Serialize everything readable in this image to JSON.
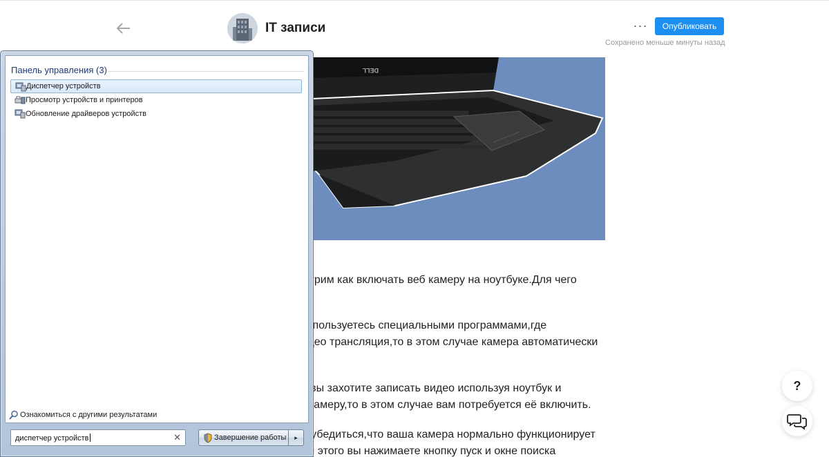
{
  "editor": {
    "channel_title": "IT записи",
    "more_label": "···",
    "publish_label": "Опубликовать",
    "saved_status": "Сохранено меньше минуты назад"
  },
  "article": {
    "paragraphs": [
      "мотрим как включать веб камеру на ноутбуке.Для чего",
      "вы пользуетесь специальными программами,где",
      "видео трансляция,то в этом случае камера автоматически",
      "ру вы захотите записать видео используя ноутбук и",
      "го камеру,то в этом случае вам потребуется её включить.",
      "но убедиться,что ваша камера нормально функционирует",
      "для этого вы нажимаете кнопку пуск и окне поиска"
    ],
    "image_brand": "DELL"
  },
  "floating": {
    "help_label": "?"
  },
  "start_menu": {
    "section_header": "Панель управления (3)",
    "results": [
      {
        "label": "Диспетчер устройств",
        "icon": "device-manager-icon",
        "selected": true
      },
      {
        "label": "Просмотр устройств и принтеров",
        "icon": "devices-printers-icon",
        "selected": false
      },
      {
        "label": "Обновление драйверов устройств",
        "icon": "driver-update-icon",
        "selected": false
      }
    ],
    "more_results_label": "Ознакомиться с другими результатами",
    "search_value": "диспетчер устройств",
    "clear_label": "✕",
    "shutdown_label": "Завершение работы",
    "shutdown_arrow": "▸"
  },
  "colors": {
    "publish_blue": "#1d8ff0",
    "image_background": "#6d8dbf",
    "selection_border": "#8fb4de"
  }
}
